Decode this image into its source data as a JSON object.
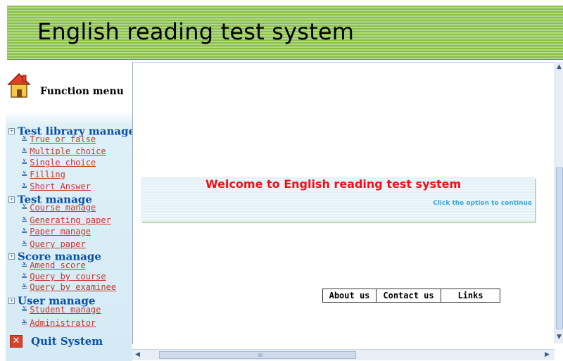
{
  "header": {
    "title": "English reading test system"
  },
  "sidebar": {
    "title": "Function menu",
    "sections": [
      {
        "label": "Test library manage",
        "items": [
          "True or false",
          "Multiple choice",
          "Single choice",
          "Filling",
          "Short Answer"
        ]
      },
      {
        "label": "Test manage",
        "items": [
          "Course manage",
          "Generating paper",
          "Paper manage",
          "Query paper"
        ]
      },
      {
        "label": "Score manage",
        "items": [
          "Amend score",
          "Query by course",
          "Query by examinee"
        ]
      },
      {
        "label": "User manage",
        "items": [
          "Student manage",
          "Administrator"
        ]
      }
    ],
    "quit_label": "Quit System"
  },
  "main": {
    "welcome": "Welcome to English reading test system",
    "hint": "Click the option to continue",
    "buttons": {
      "about": "About us",
      "contact": "Contact us",
      "links": "Links"
    }
  },
  "colors": {
    "header_green": "#8cbf4a",
    "link": "#c43a2c",
    "section": "#0a4fa8",
    "welcome": "#ee1111",
    "hint": "#3ba7d8"
  },
  "icons": {
    "function_menu": "house-icon",
    "section": "expand-plus-icon",
    "item": "double-chevron-down-icon",
    "quit": "close-x-icon"
  }
}
